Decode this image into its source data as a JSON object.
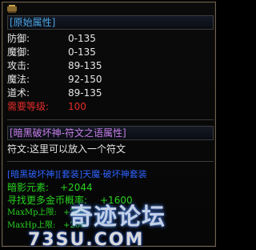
{
  "base_section": {
    "header": "[原始属性]",
    "stats": [
      {
        "label": "防御:",
        "value": "0-135"
      },
      {
        "label": "魔御:",
        "value": "0-135"
      },
      {
        "label": "攻击:",
        "value": "89-135"
      },
      {
        "label": "魔法:",
        "value": "92-150"
      },
      {
        "label": "道术:",
        "value": "89-135"
      }
    ],
    "requirement": {
      "label": "需要等级:",
      "value": "100"
    }
  },
  "rune_section": {
    "header": "[暗黑破坏神-符文之语属性]",
    "slot_text": "符文:这里可以放入一个符文"
  },
  "set_section": {
    "title": "[暗黑破坏神][套装]天魔·破坏神套装",
    "lines": [
      {
        "label": "暗影元素:",
        "value": "+2044"
      },
      {
        "label": "寻找更多金币概率:",
        "value": "+1600"
      },
      {
        "label": "MaxMp上限:",
        "value": "+200"
      },
      {
        "label": "MaxHp上限:",
        "value": "+200"
      }
    ]
  },
  "watermark": {
    "cn": "奇迹论坛",
    "en": "73SU.COM"
  },
  "colors": {
    "base_header": "#4aa5e8",
    "rune_header": "#c77de8",
    "requirement": "#e52b2b",
    "set_title": "#2f63ff",
    "bonus": "#27d21f",
    "border": "#6d6152"
  }
}
